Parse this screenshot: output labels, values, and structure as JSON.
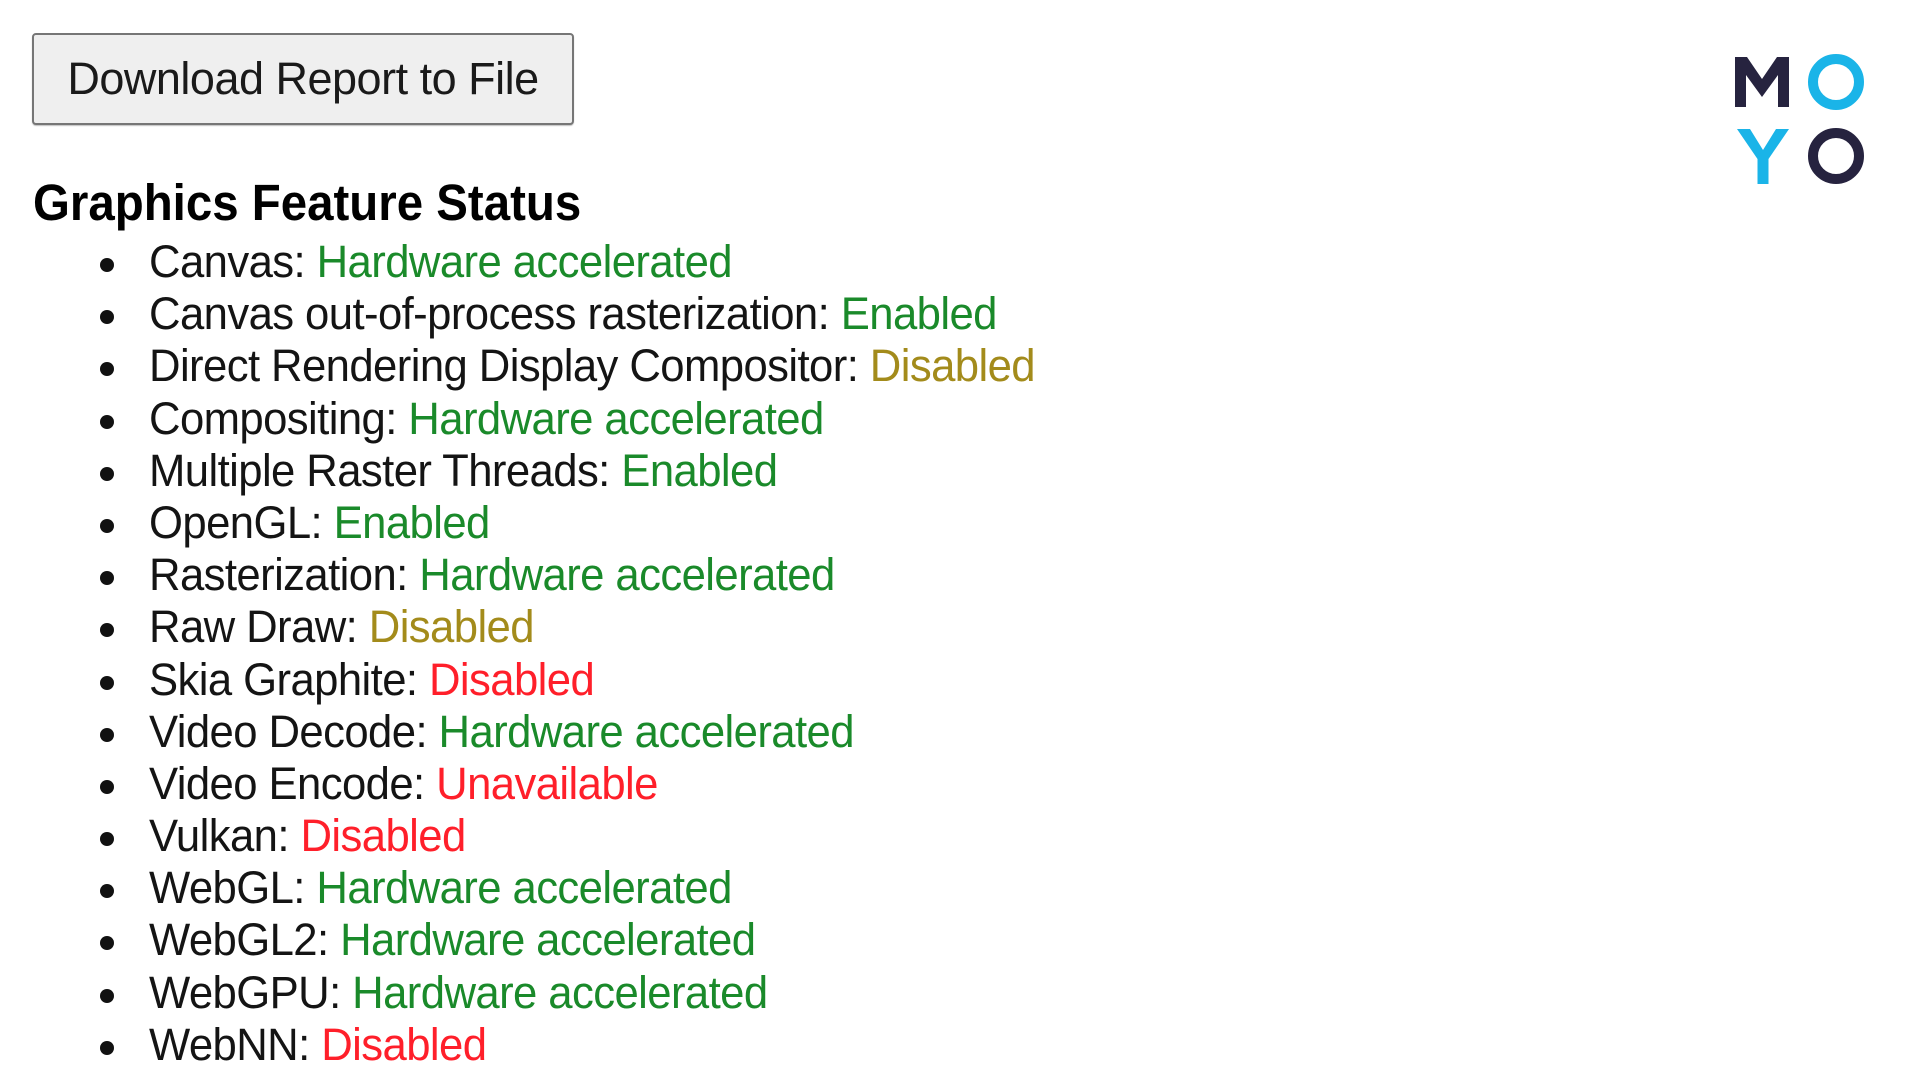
{
  "toolbar": {
    "download_label": "Download Report to File"
  },
  "section": {
    "title": "Graphics Feature Status"
  },
  "logo": {
    "letters": [
      "M",
      "O",
      "Y",
      "O"
    ],
    "colors": {
      "dark": "#26233f",
      "cyan": "#1ab4e8"
    }
  },
  "status_colors": {
    "enabled": "#1a8a2a",
    "software_or_partial": "#a38b1b",
    "disabled": "#ff1f2a"
  },
  "features": [
    {
      "name": "Canvas",
      "status": "Hardware accelerated",
      "tone": "green"
    },
    {
      "name": "Canvas out-of-process rasterization",
      "status": "Enabled",
      "tone": "green"
    },
    {
      "name": "Direct Rendering Display Compositor",
      "status": "Disabled",
      "tone": "yellow"
    },
    {
      "name": "Compositing",
      "status": "Hardware accelerated",
      "tone": "green"
    },
    {
      "name": "Multiple Raster Threads",
      "status": "Enabled",
      "tone": "green"
    },
    {
      "name": "OpenGL",
      "status": "Enabled",
      "tone": "green"
    },
    {
      "name": "Rasterization",
      "status": "Hardware accelerated",
      "tone": "green"
    },
    {
      "name": "Raw Draw",
      "status": "Disabled",
      "tone": "yellow"
    },
    {
      "name": "Skia Graphite",
      "status": "Disabled",
      "tone": "red"
    },
    {
      "name": "Video Decode",
      "status": "Hardware accelerated",
      "tone": "green"
    },
    {
      "name": "Video Encode",
      "status": "Unavailable",
      "tone": "red"
    },
    {
      "name": "Vulkan",
      "status": "Disabled",
      "tone": "red"
    },
    {
      "name": "WebGL",
      "status": "Hardware accelerated",
      "tone": "green"
    },
    {
      "name": "WebGL2",
      "status": "Hardware accelerated",
      "tone": "green"
    },
    {
      "name": "WebGPU",
      "status": "Hardware accelerated",
      "tone": "green"
    },
    {
      "name": "WebNN",
      "status": "Disabled",
      "tone": "red"
    }
  ]
}
